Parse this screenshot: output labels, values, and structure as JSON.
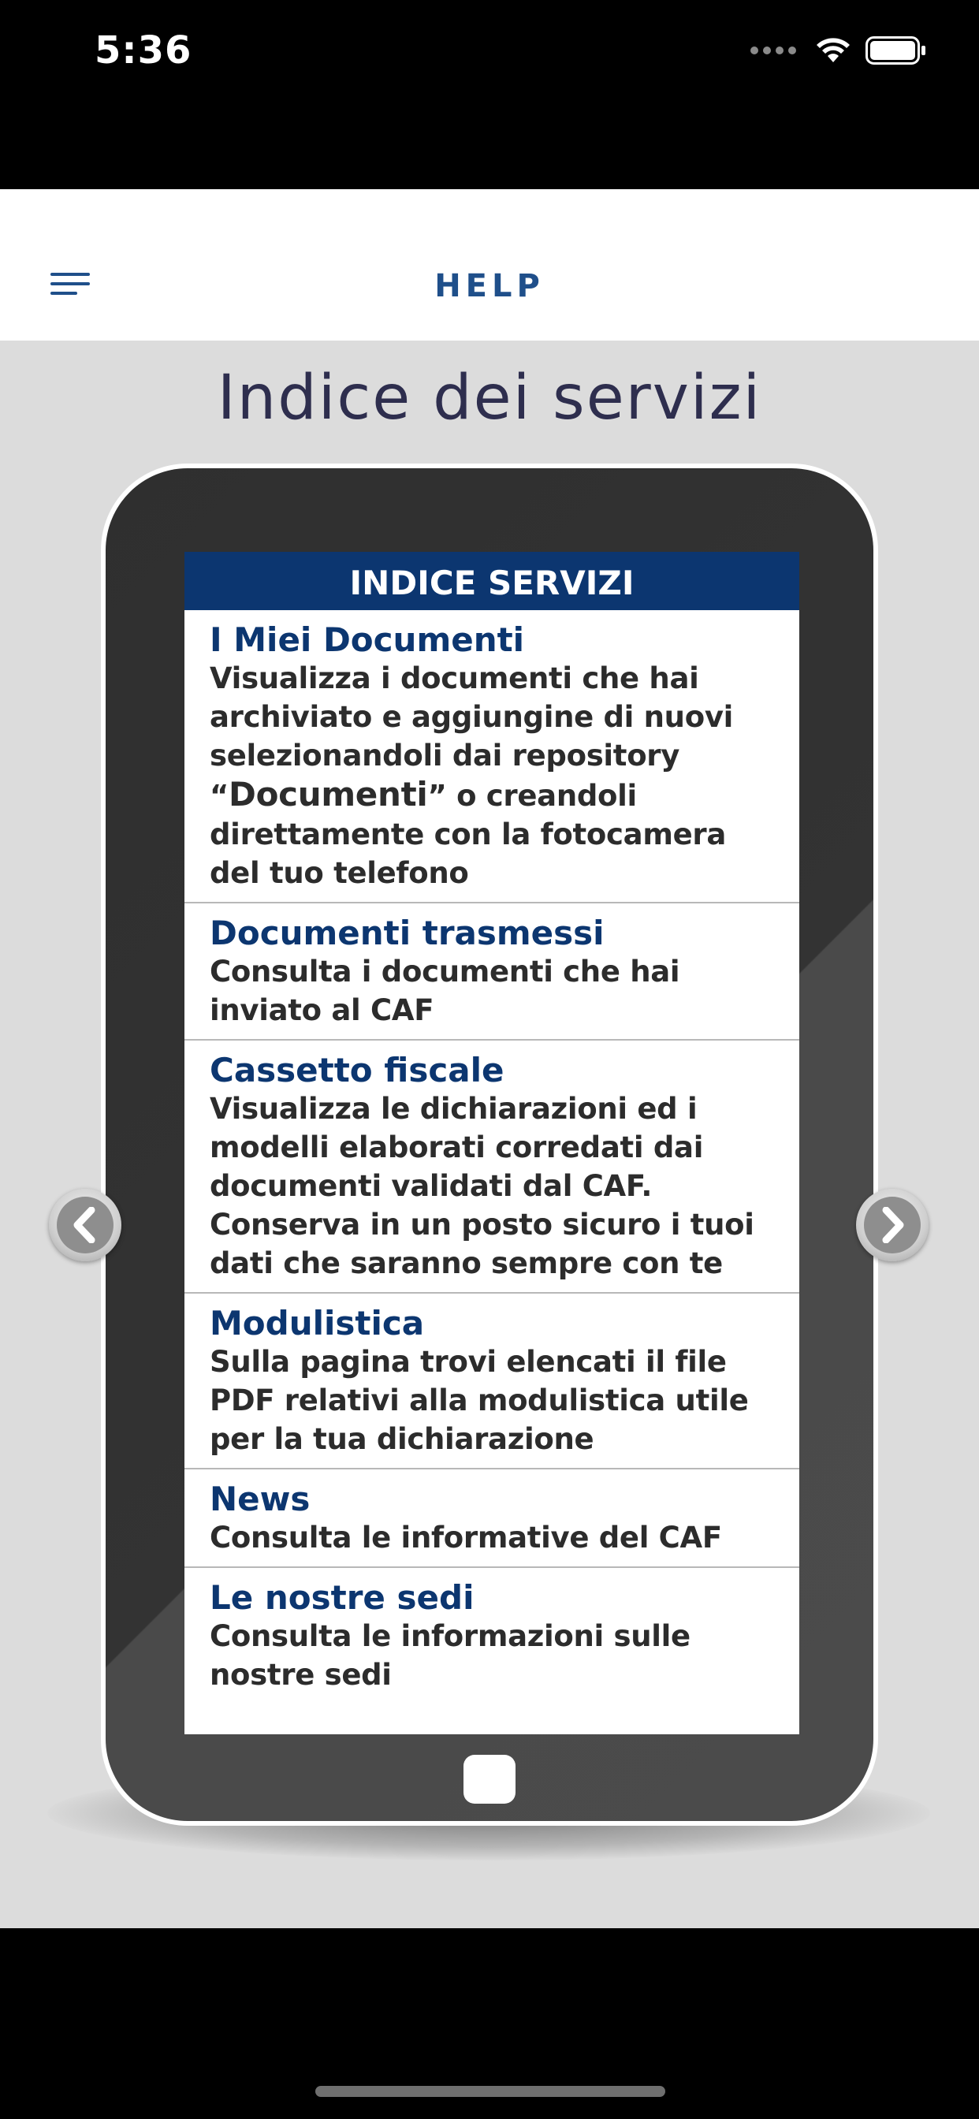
{
  "status_bar": {
    "time": "5:36",
    "icons": [
      "signal-dots-icon",
      "wifi-icon",
      "battery-icon"
    ]
  },
  "nav": {
    "title": "HELP",
    "menu_icon": "menu-icon",
    "accent_color": "#1f4f8a"
  },
  "page": {
    "title": "Indice dei servizi"
  },
  "tablet": {
    "header": "INDICE SERVIZI",
    "header_color": "#0c3670",
    "services": [
      {
        "title": "I Miei Documenti",
        "desc_pre": "Visualizza i documenti che hai archiviato e aggiungine di nuovi selezionandoli dai repository “",
        "desc_big": "Documenti",
        "desc_post": "” o creandoli direttamente con la fotocamera del tuo telefono"
      },
      {
        "title": "Documenti trasmessi",
        "desc": "Consulta i documenti che hai inviato al CAF"
      },
      {
        "title": "Cassetto fiscale",
        "desc": "Visualizza le dichiarazioni ed i modelli elaborati corredati dai documenti validati dal CAF. Conserva in un posto sicuro i tuoi dati che saranno sempre con te"
      },
      {
        "title": "Modulistica",
        "desc": "Sulla pagina trovi elencati il file PDF relativi alla modulistica utile per la tua dichiarazione"
      },
      {
        "title": "News",
        "desc": "Consulta le informative del CAF"
      },
      {
        "title": "Le nostre sedi",
        "desc": "Consulta le informazioni sulle nostre sedi"
      }
    ]
  },
  "carousel": {
    "prev_icon": "chevron-left-icon",
    "next_icon": "chevron-right-icon"
  }
}
